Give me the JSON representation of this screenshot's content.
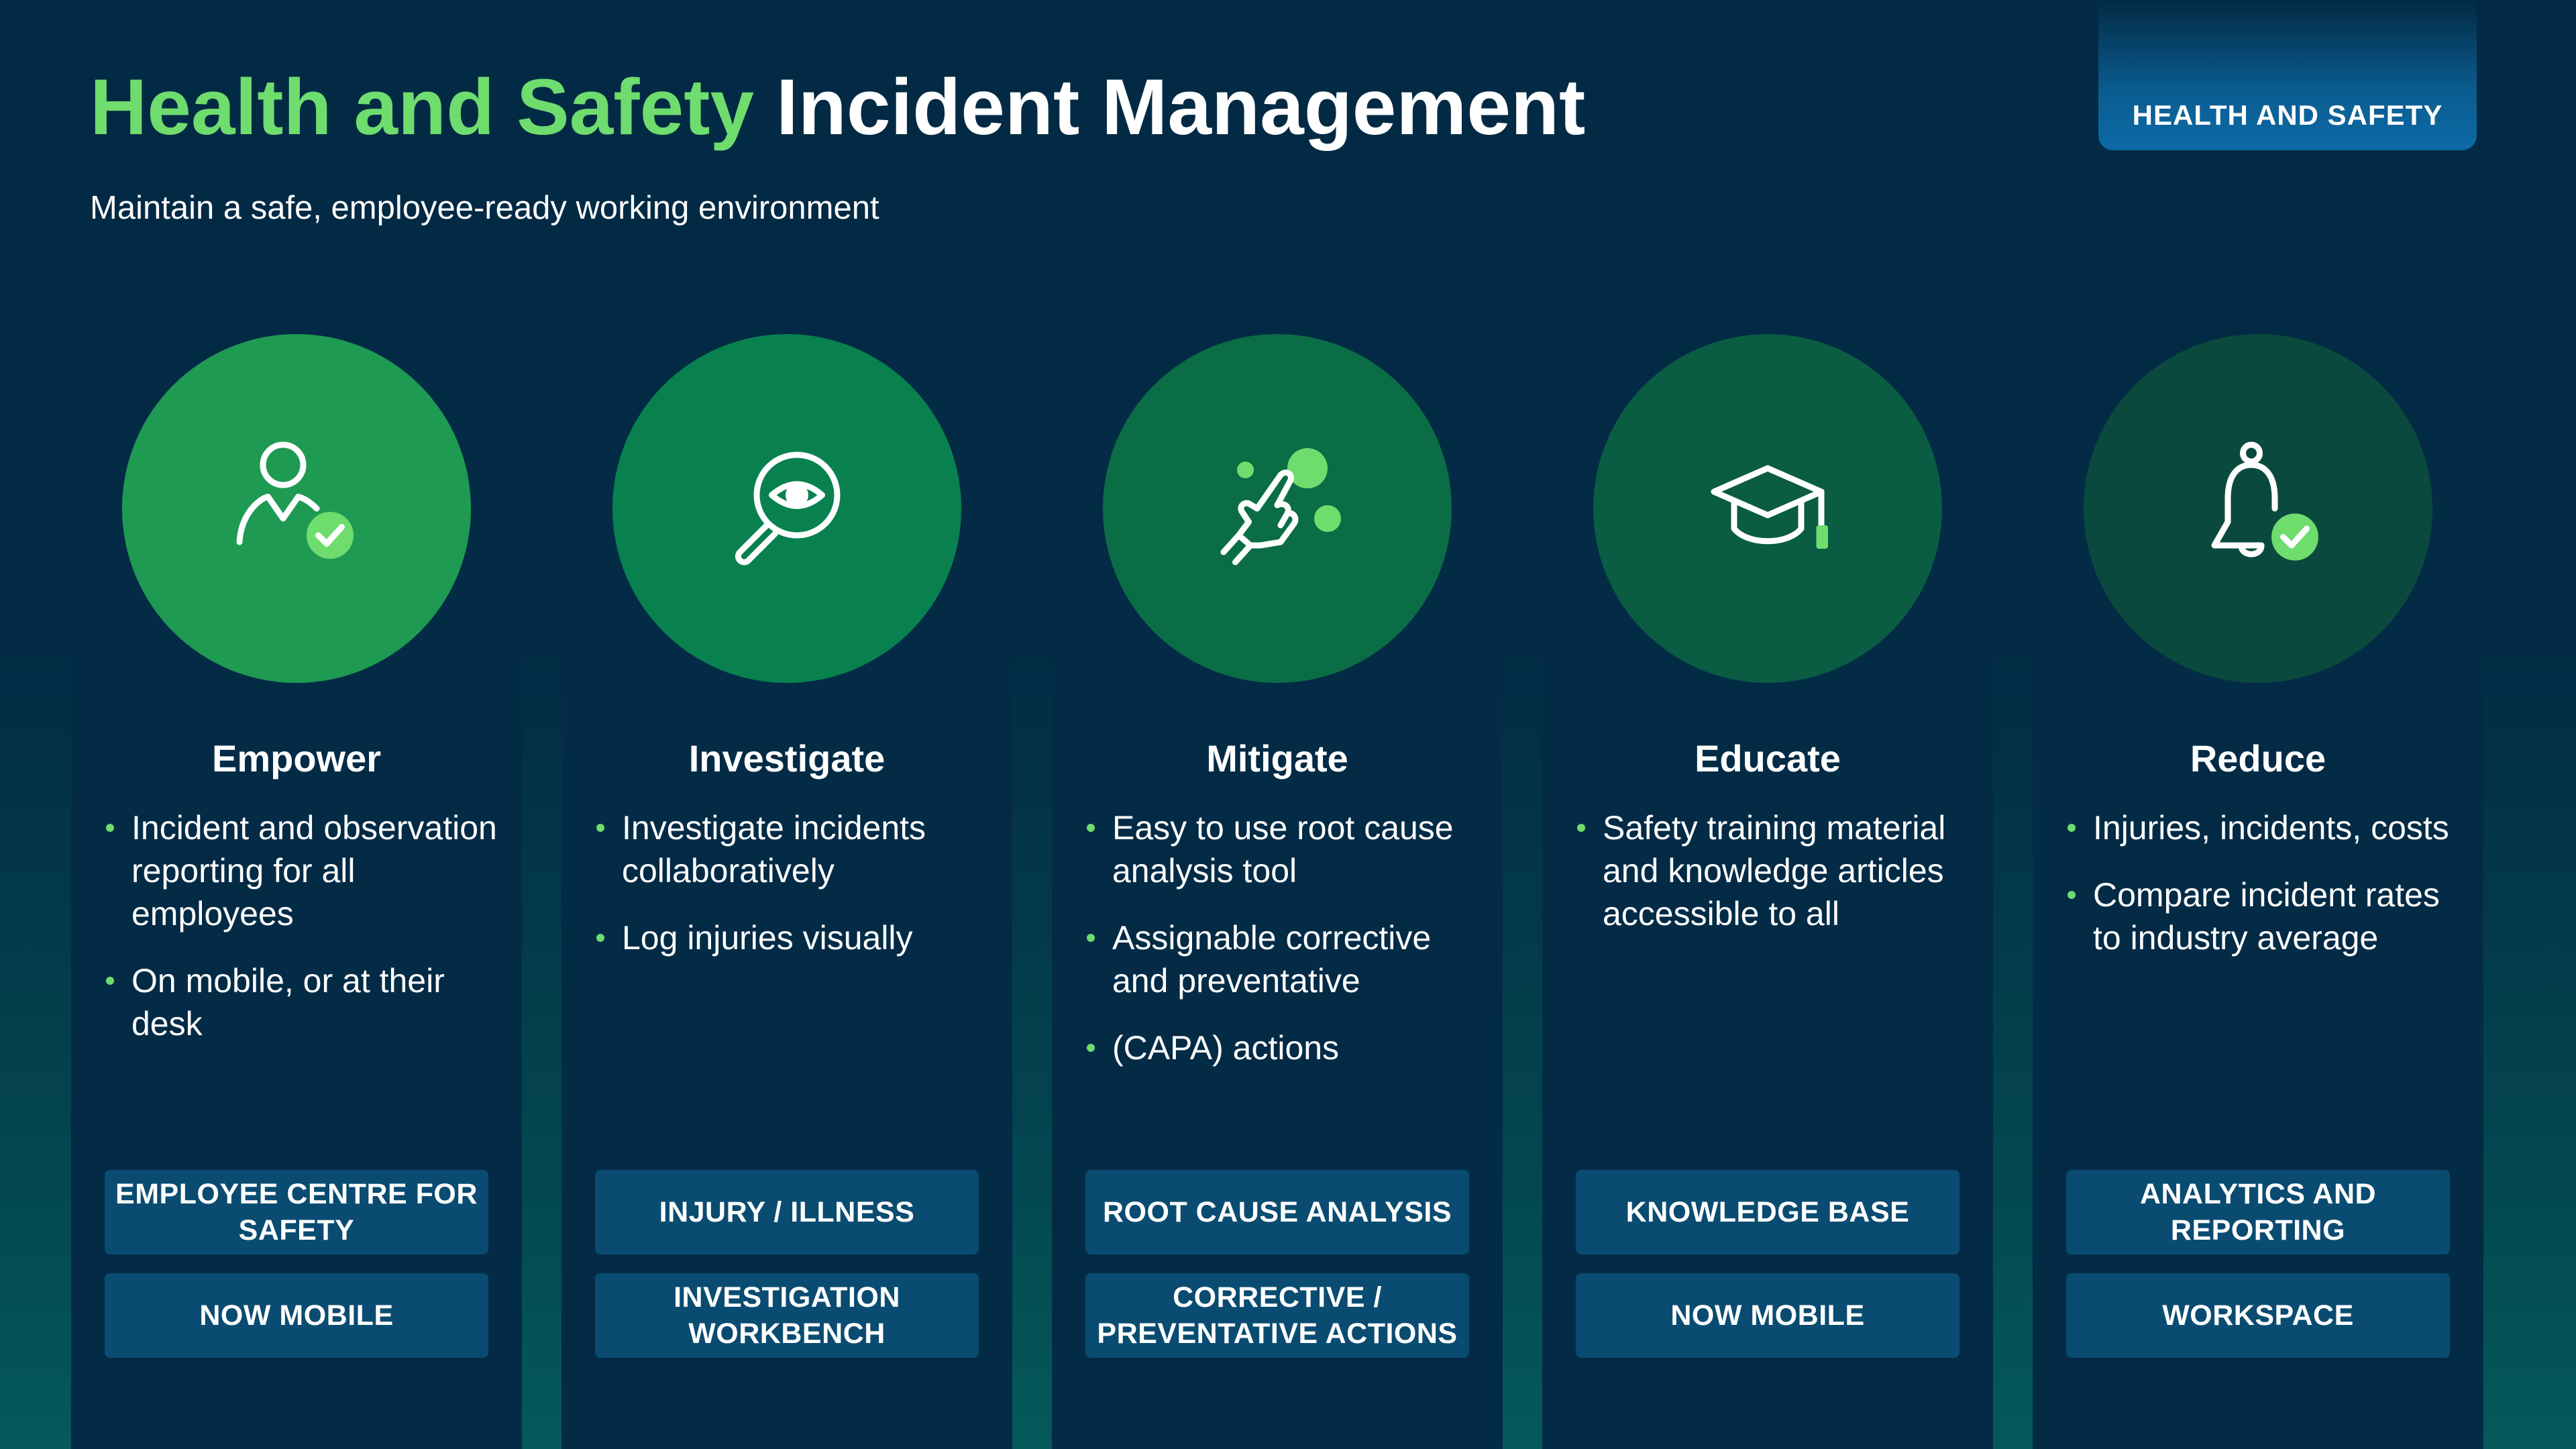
{
  "header": {
    "title_accent": "Health and Safety",
    "title_rest": "Incident Management",
    "subtitle": "Maintain a safe, employee-ready working environment",
    "badge": "HEALTH AND SAFETY"
  },
  "colors": {
    "accent_green": "#6fdc6e",
    "background": "#032a44",
    "card": "#042b46",
    "tag": "#0a4c71"
  },
  "columns": [
    {
      "title": "Empower",
      "icon": "user-check-icon",
      "circle_color": "#1f9a52",
      "bullets": [
        "Incident and observation reporting for all employees",
        "On mobile, or at their desk"
      ],
      "tags": [
        "EMPLOYEE CENTRE FOR SAFETY",
        "NOW MOBILE"
      ]
    },
    {
      "title": "Investigate",
      "icon": "magnifier-eye-icon",
      "circle_color": "#08814f",
      "bullets": [
        "Investigate incidents collaboratively",
        "Log injuries visually"
      ],
      "tags": [
        "INJURY / ILLNESS",
        "INVESTIGATION WORKBENCH"
      ]
    },
    {
      "title": "Mitigate",
      "icon": "hand-tap-icon",
      "circle_color": "#0a6d45",
      "bullets": [
        "Easy to use root cause analysis tool",
        "Assignable corrective and preventative",
        "(CAPA) actions"
      ],
      "tags": [
        "ROOT CAUSE ANALYSIS",
        "CORRECTIVE / PREVENTATIVE ACTIONS"
      ]
    },
    {
      "title": "Educate",
      "icon": "graduation-cap-icon",
      "circle_color": "#0a5c43",
      "bullets": [
        "Safety training material and knowledge articles accessible to all"
      ],
      "tags": [
        "KNOWLEDGE BASE",
        "NOW MOBILE"
      ]
    },
    {
      "title": "Reduce",
      "icon": "bell-check-icon",
      "circle_color": "#0a4a3e",
      "bullets": [
        "Injuries, incidents, costs",
        "Compare incident rates to industry average"
      ],
      "tags": [
        "ANALYTICS AND REPORTING",
        "WORKSPACE"
      ]
    }
  ]
}
